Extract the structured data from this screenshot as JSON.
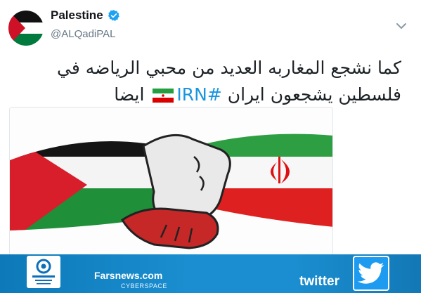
{
  "tweet": {
    "display_name": "Palestine",
    "handle": "@ALQadiPAL",
    "line1": "كما نشجع المغاربه العديد من محبي الرياضه في",
    "line2_before": "فلسطين  يشجعون ايران",
    "hashtag": "#IRN",
    "line2_after": "ايضا"
  },
  "icons": {
    "avatar": "palestine-flag-icon",
    "verified": "verified-badge-icon",
    "menu": "chevron-down-icon",
    "emoji": "iran-flag-icon",
    "twitter": "twitter-bird-icon"
  },
  "banner": {
    "source": "Farsnews.com",
    "sub": "CYBERSPACE",
    "platform": "twitter"
  },
  "colors": {
    "link": "#1b95e0",
    "verified": "#1da1f2",
    "banner": "#1a8ed0",
    "palestine_red": "#ce1126",
    "palestine_green": "#007a3d",
    "iran_green": "#239f40",
    "iran_red": "#da0000"
  }
}
